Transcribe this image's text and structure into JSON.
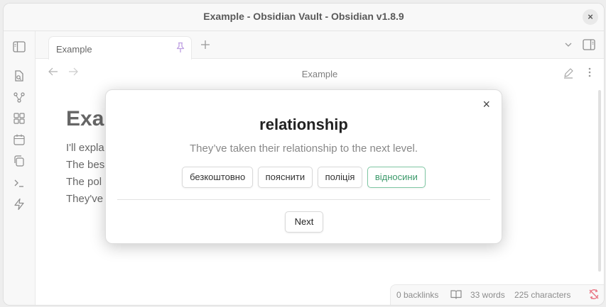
{
  "window": {
    "title": "Example - Obsidian Vault - Obsidian v1.8.9",
    "close_glyph": "×"
  },
  "tab": {
    "label": "Example",
    "pin_icon": "pin-icon",
    "new_tab_glyph": "+"
  },
  "view": {
    "title": "Example"
  },
  "ribbon": {
    "icons": [
      "open-file-icon",
      "graph-icon",
      "canvas-icon",
      "calendar-icon",
      "templates-icon",
      "terminal-icon",
      "command-icon"
    ]
  },
  "document": {
    "heading": "Exa",
    "lines": [
      "I'll expla",
      "The bes",
      "The pol",
      "They've"
    ]
  },
  "status": {
    "backlinks": "0 backlinks",
    "words": "33 words",
    "characters": "225 characters"
  },
  "modal": {
    "word": "relationship",
    "sentence": "They’ve taken their relationship to the next level.",
    "options": [
      "безкоштовно",
      "пояснити",
      "поліція",
      "відносини"
    ],
    "correct_index": 3,
    "next_label": "Next",
    "close_glyph": "×"
  },
  "colors": {
    "accent_correct": "#3c9a6b",
    "pin_accent": "#a87fd8",
    "sync_error": "#e0465a"
  }
}
